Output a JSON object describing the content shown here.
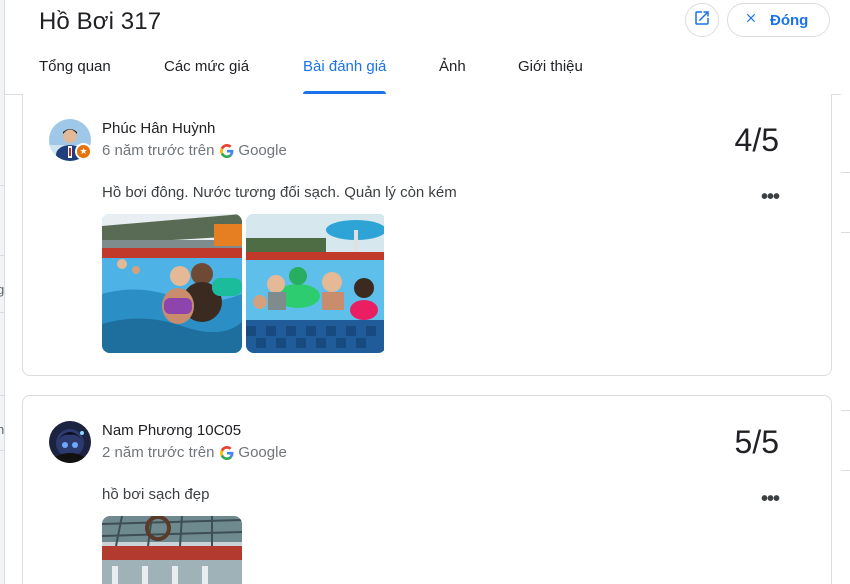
{
  "header": {
    "title": "Hồ Bơi 317",
    "close_label": "Đóng"
  },
  "tabs": [
    {
      "label": "Tổng quan"
    },
    {
      "label": "Các mức giá"
    },
    {
      "label": "Bài đánh giá"
    },
    {
      "label": "Ảnh"
    },
    {
      "label": "Giới thiệu"
    }
  ],
  "active_tab": "Bài đánh giá",
  "reviews": [
    {
      "author": "Phúc Hân Huỳnh",
      "time": "6 năm trước trên",
      "source": "Google",
      "rating": "4/5",
      "text": "Hồ bơi đông. Nước tương đối sạch. Quản lý còn kém",
      "local_guide": true,
      "photos": 2
    },
    {
      "author": "Nam Phương 10C05",
      "time": "2 năm trước trên",
      "source": "Google",
      "rating": "5/5",
      "text": "hồ bơi sạch đẹp",
      "local_guide": false,
      "photos": 1
    }
  ],
  "colors": {
    "accent": "#1a73e8",
    "badge": "#e8710a",
    "border": "#dadce0"
  },
  "icons": {
    "open": "open-in-new-icon",
    "close": "close-icon",
    "more": "more-horiz-icon",
    "google": "google-g-icon",
    "local_guide": "local-guide-star-icon"
  }
}
